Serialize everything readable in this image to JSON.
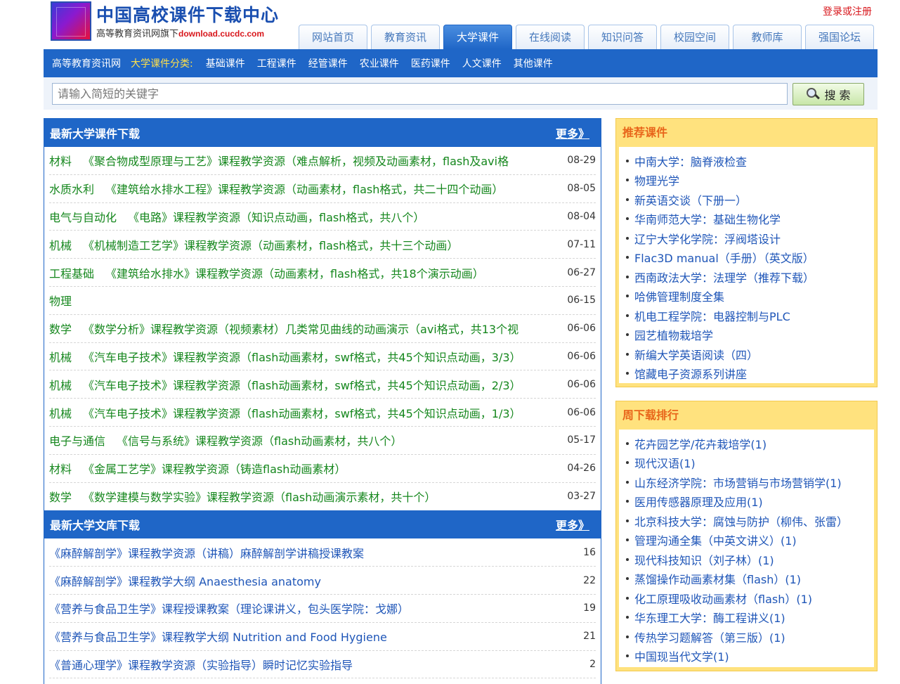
{
  "header": {
    "title": "中国高校课件下载中心",
    "subtitle": "高等教育资讯网旗下",
    "domain": "download.cucdc.com",
    "login": "登录或注册"
  },
  "nav_tabs": [
    "网站首页",
    "教育资讯",
    "大学课件",
    "在线阅读",
    "知识问答",
    "校园空间",
    "教师库",
    "强国论坛"
  ],
  "nav_active_index": 2,
  "category_bar": {
    "home": "高等教育资讯网",
    "label": "大学课件分类:",
    "links": [
      "基础课件",
      "工程课件",
      "经管课件",
      "农业课件",
      "医药课件",
      "人文课件",
      "其他课件"
    ]
  },
  "search": {
    "placeholder": "请输入简短的关键字",
    "button": "搜 索"
  },
  "latest_courseware": {
    "title": "最新大学课件下载",
    "more": "更多》",
    "items": [
      {
        "cat": "材料",
        "title": "《聚合物成型原理与工艺》课程教学资源（难点解析，视频及动画素材，flash及avi格",
        "date": "08-29"
      },
      {
        "cat": "水质水利",
        "title": "《建筑给水排水工程》课程教学资源（动画素材，flash格式，共二十四个动画）",
        "date": "08-05"
      },
      {
        "cat": "电气与自动化",
        "title": "《电路》课程教学资源（知识点动画，flash格式，共八个）",
        "date": "08-04"
      },
      {
        "cat": "机械",
        "title": "《机械制造工艺学》课程教学资源（动画素材，flash格式，共十三个动画）",
        "date": "07-11"
      },
      {
        "cat": "工程基础",
        "title": "《建筑给水排水》课程教学资源（动画素材，flash格式，共18个演示动画）",
        "date": "06-27"
      },
      {
        "cat": "物理",
        "title": "",
        "date": "06-15"
      },
      {
        "cat": "数学",
        "title": "《数学分析》课程教学资源（视频素材）几类常见曲线的动画演示（avi格式，共13个视",
        "date": "06-06"
      },
      {
        "cat": "机械",
        "title": "《汽车电子技术》课程教学资源（flash动画素材，swf格式，共45个知识点动画，3/3）",
        "date": "06-06"
      },
      {
        "cat": "机械",
        "title": "《汽车电子技术》课程教学资源（flash动画素材，swf格式，共45个知识点动画，2/3）",
        "date": "06-06"
      },
      {
        "cat": "机械",
        "title": "《汽车电子技术》课程教学资源（flash动画素材，swf格式，共45个知识点动画，1/3）",
        "date": "06-06"
      },
      {
        "cat": "电子与通信",
        "title": "《信号与系统》课程教学资源（flash动画素材，共八个）",
        "date": "05-17"
      },
      {
        "cat": "材料",
        "title": "《金属工艺学》课程教学资源（铸造flash动画素材）",
        "date": "04-26"
      },
      {
        "cat": "数学",
        "title": "《数学建模与数学实验》课程教学资源（flash动画演示素材，共十个）",
        "date": "03-27"
      }
    ]
  },
  "latest_library": {
    "title": "最新大学文库下载",
    "more": "更多》",
    "items": [
      {
        "title": "《麻醉解剖学》课程教学资源（讲稿）麻醉解剖学讲稿授课教案",
        "count": "16"
      },
      {
        "title": "《麻醉解剖学》课程教学大纲 Anaesthesia anatomy",
        "count": "22"
      },
      {
        "title": "《营养与食品卫生学》课程授课教案（理论课讲义，包头医学院：戈娜）",
        "count": "19"
      },
      {
        "title": "《营养与食品卫生学》课程教学大纲 Nutrition and Food Hygiene",
        "count": "21"
      },
      {
        "title": "《普通心理学》课程教学资源（实验指导）瞬时记忆实验指导",
        "count": "2"
      }
    ]
  },
  "recommended": {
    "title": "推荐课件",
    "items": [
      "中南大学：脑脊液检查",
      "物理光学",
      "新英语交谈（下册一）",
      "华南师范大学：基础生物化学",
      "辽宁大学化学院：浮阀塔设计",
      "Flac3D manual（手册）（英文版）",
      "西南政法大学：法理学（推荐下载）",
      "哈佛管理制度全集",
      "机电工程学院：电器控制与PLC",
      "园艺植物栽培学",
      "新编大学英语阅读（四）",
      "馆藏电子资源系列讲座"
    ]
  },
  "weekly_rank": {
    "title": "周下载排行",
    "items": [
      "花卉园艺学/花卉栽培学(1)",
      "现代汉语(1)",
      "山东经济学院：市场营销与市场营销学(1)",
      "医用传感器原理及应用(1)",
      "北京科技大学：腐蚀与防护（柳伟、张雷）",
      "管理沟通全集（中英文讲义）(1)",
      "现代科技知识（刘子林）(1)",
      "蒸馏操作动画素材集（flash）(1)",
      "化工原理吸收动画素材（flash）(1)",
      "华东理工大学：酶工程讲义(1)",
      "传热学习题解答（第三版）(1)",
      "中国现当代文学(1)"
    ]
  }
}
